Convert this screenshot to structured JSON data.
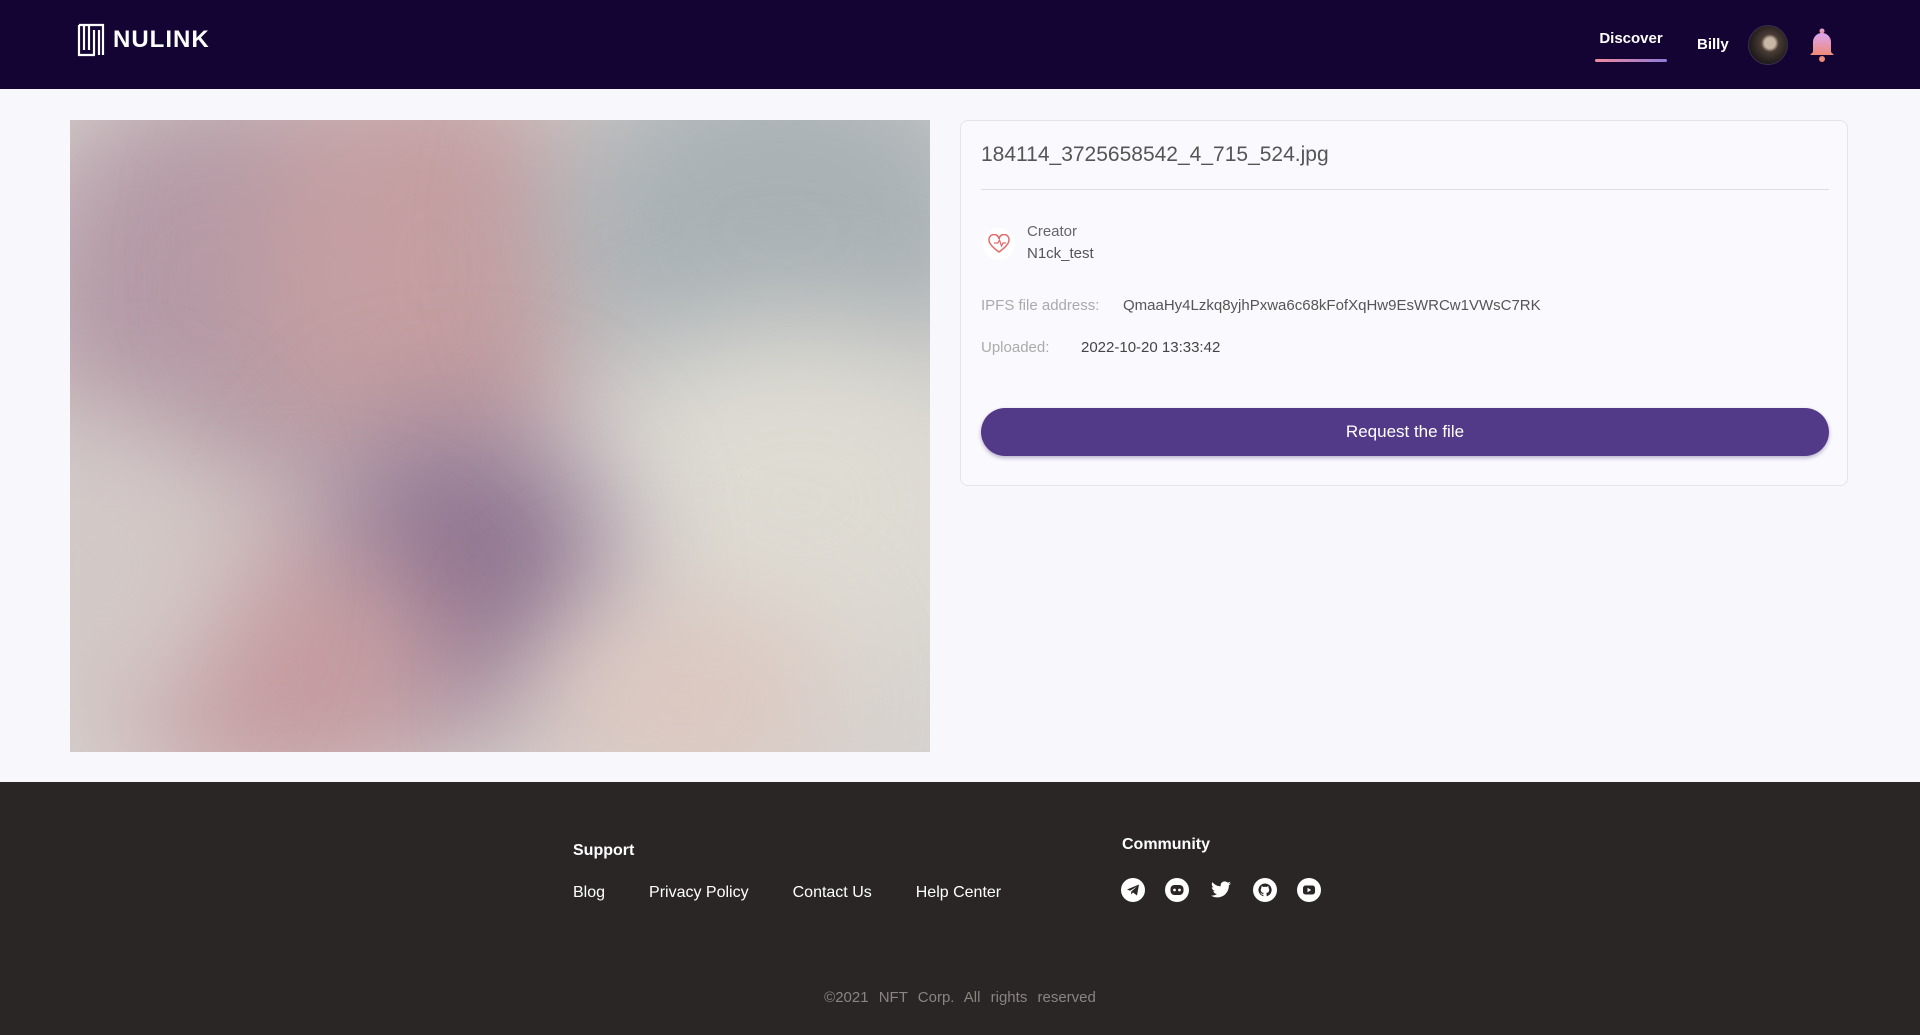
{
  "header": {
    "logo_text": "NULINK",
    "nav": {
      "discover": "Discover",
      "user": "Billy"
    }
  },
  "file": {
    "name": "184114_3725658542_4_715_524.jpg",
    "creator_label": "Creator",
    "creator_name": "N1ck_test",
    "ipfs_label": "IPFS file address:",
    "ipfs_value": "QmaaHy4Lzkq8yjhPxwa6c68kFofXqHw9EsWRCw1VWsC7RK",
    "uploaded_label": "Uploaded:",
    "uploaded_value": "2022-10-20 13:33:42",
    "request_button": "Request the file"
  },
  "footer": {
    "support_title": "Support",
    "support_links": [
      "Blog",
      "Privacy Policy",
      "Contact Us",
      "Help Center"
    ],
    "community_title": "Community",
    "social_icons": [
      "telegram-icon",
      "discord-icon",
      "twitter-icon",
      "github-icon",
      "youtube-icon"
    ],
    "copyright": "©2021 NFT Corp. All rights reserved"
  },
  "colors": {
    "header_bg": "#140434",
    "accent": "#533a88",
    "footer_bg": "#2a2625",
    "page_bg": "#f7f7fc"
  }
}
